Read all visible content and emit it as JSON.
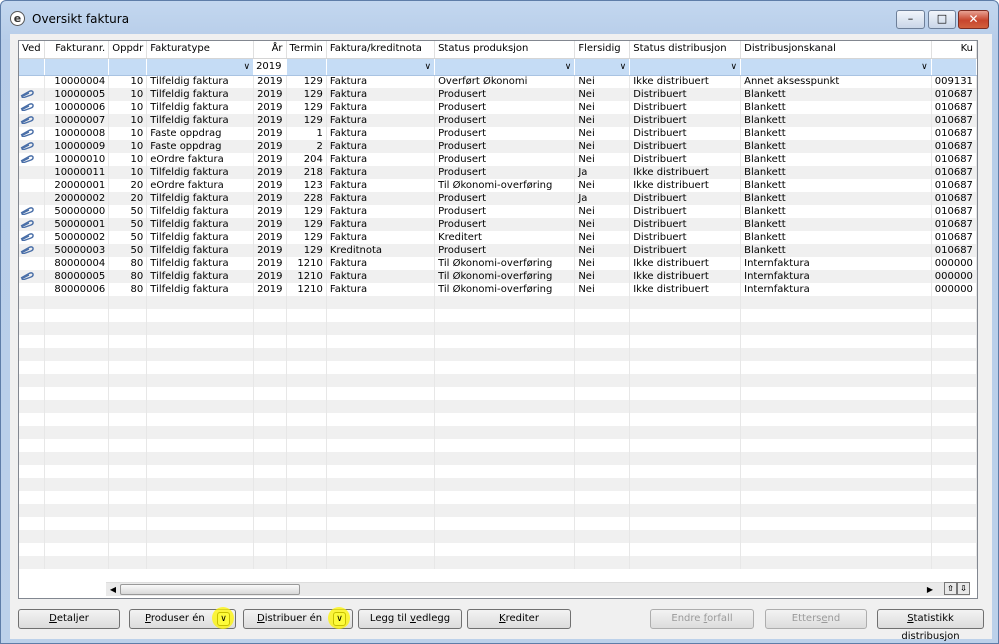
{
  "window": {
    "title": "Oversikt faktura",
    "icon": "app-e-icon",
    "min": "minimize-icon",
    "max": "maximize-icon",
    "close": "close-icon"
  },
  "columns": [
    {
      "label": "Ved"
    },
    {
      "label": "Fakturanr."
    },
    {
      "label": "Oppdr"
    },
    {
      "label": "Fakturatype"
    },
    {
      "label": "År"
    },
    {
      "label": "Termin"
    },
    {
      "label": "Faktura/kreditnota"
    },
    {
      "label": "Status produksjon"
    },
    {
      "label": "Flersidig"
    },
    {
      "label": "Status distribusjon"
    },
    {
      "label": "Distribusjonskanal"
    },
    {
      "label": "Ku"
    }
  ],
  "filter": {
    "year": "2019"
  },
  "rows": [
    {
      "clip": false,
      "nr": "10000004",
      "oppdr": "10",
      "type": "Tilfeldig faktura",
      "ar": "2019",
      "termin": "129",
      "fk": "Faktura",
      "status": "Overført Økonomi",
      "fler": "Nei",
      "dist": "Ikke distribuert",
      "kanal": "Annet aksesspunkt",
      "ku": "009131"
    },
    {
      "clip": true,
      "nr": "10000005",
      "oppdr": "10",
      "type": "Tilfeldig faktura",
      "ar": "2019",
      "termin": "129",
      "fk": "Faktura",
      "status": "Produsert",
      "fler": "Nei",
      "dist": "Distribuert",
      "kanal": "Blankett",
      "ku": "010687"
    },
    {
      "clip": true,
      "nr": "10000006",
      "oppdr": "10",
      "type": "Tilfeldig faktura",
      "ar": "2019",
      "termin": "129",
      "fk": "Faktura",
      "status": "Produsert",
      "fler": "Nei",
      "dist": "Distribuert",
      "kanal": "Blankett",
      "ku": "010687"
    },
    {
      "clip": true,
      "nr": "10000007",
      "oppdr": "10",
      "type": "Tilfeldig faktura",
      "ar": "2019",
      "termin": "129",
      "fk": "Faktura",
      "status": "Produsert",
      "fler": "Nei",
      "dist": "Distribuert",
      "kanal": "Blankett",
      "ku": "010687"
    },
    {
      "clip": true,
      "nr": "10000008",
      "oppdr": "10",
      "type": "Faste oppdrag",
      "ar": "2019",
      "termin": "1",
      "fk": "Faktura",
      "status": "Produsert",
      "fler": "Nei",
      "dist": "Distribuert",
      "kanal": "Blankett",
      "ku": "010687"
    },
    {
      "clip": true,
      "nr": "10000009",
      "oppdr": "10",
      "type": "Faste oppdrag",
      "ar": "2019",
      "termin": "2",
      "fk": "Faktura",
      "status": "Produsert",
      "fler": "Nei",
      "dist": "Distribuert",
      "kanal": "Blankett",
      "ku": "010687"
    },
    {
      "clip": true,
      "nr": "10000010",
      "oppdr": "10",
      "type": "eOrdre faktura",
      "ar": "2019",
      "termin": "204",
      "fk": "Faktura",
      "status": "Produsert",
      "fler": "Nei",
      "dist": "Distribuert",
      "kanal": "Blankett",
      "ku": "010687"
    },
    {
      "clip": false,
      "nr": "10000011",
      "oppdr": "10",
      "type": "Tilfeldig faktura",
      "ar": "2019",
      "termin": "218",
      "fk": "Faktura",
      "status": "Produsert",
      "fler": "Ja",
      "dist": "Ikke distribuert",
      "kanal": "Blankett",
      "ku": "010687"
    },
    {
      "clip": false,
      "nr": "20000001",
      "oppdr": "20",
      "type": "eOrdre faktura",
      "ar": "2019",
      "termin": "123",
      "fk": "Faktura",
      "status": "Til Økonomi-overføring",
      "fler": "Nei",
      "dist": "Ikke distribuert",
      "kanal": "Blankett",
      "ku": "010687"
    },
    {
      "clip": false,
      "nr": "20000002",
      "oppdr": "20",
      "type": "Tilfeldig faktura",
      "ar": "2019",
      "termin": "228",
      "fk": "Faktura",
      "status": "Produsert",
      "fler": "Ja",
      "dist": "Distribuert",
      "kanal": "Blankett",
      "ku": "010687"
    },
    {
      "clip": true,
      "nr": "50000000",
      "oppdr": "50",
      "type": "Tilfeldig faktura",
      "ar": "2019",
      "termin": "129",
      "fk": "Faktura",
      "status": "Produsert",
      "fler": "Nei",
      "dist": "Distribuert",
      "kanal": "Blankett",
      "ku": "010687"
    },
    {
      "clip": true,
      "nr": "50000001",
      "oppdr": "50",
      "type": "Tilfeldig faktura",
      "ar": "2019",
      "termin": "129",
      "fk": "Faktura",
      "status": "Produsert",
      "fler": "Nei",
      "dist": "Distribuert",
      "kanal": "Blankett",
      "ku": "010687"
    },
    {
      "clip": true,
      "nr": "50000002",
      "oppdr": "50",
      "type": "Tilfeldig faktura",
      "ar": "2019",
      "termin": "129",
      "fk": "Faktura",
      "status": "Kreditert",
      "fler": "Nei",
      "dist": "Distribuert",
      "kanal": "Blankett",
      "ku": "010687"
    },
    {
      "clip": true,
      "nr": "50000003",
      "oppdr": "50",
      "type": "Tilfeldig faktura",
      "ar": "2019",
      "termin": "129",
      "fk": "Kreditnota",
      "status": "Produsert",
      "fler": "Nei",
      "dist": "Distribuert",
      "kanal": "Blankett",
      "ku": "010687"
    },
    {
      "clip": false,
      "nr": "80000004",
      "oppdr": "80",
      "type": "Tilfeldig faktura",
      "ar": "2019",
      "termin": "1210",
      "fk": "Faktura",
      "status": "Til Økonomi-overføring",
      "fler": "Nei",
      "dist": "Ikke distribuert",
      "kanal": "Internfaktura",
      "ku": "000000"
    },
    {
      "clip": true,
      "nr": "80000005",
      "oppdr": "80",
      "type": "Tilfeldig faktura",
      "ar": "2019",
      "termin": "1210",
      "fk": "Faktura",
      "status": "Til Økonomi-overføring",
      "fler": "Nei",
      "dist": "Ikke distribuert",
      "kanal": "Internfaktura",
      "ku": "000000"
    },
    {
      "clip": false,
      "nr": "80000006",
      "oppdr": "80",
      "type": "Tilfeldig faktura",
      "ar": "2019",
      "termin": "1210",
      "fk": "Faktura",
      "status": "Til Økonomi-overføring",
      "fler": "Nei",
      "dist": "Ikke distribuert",
      "kanal": "Internfaktura",
      "ku": "000000"
    }
  ],
  "buttons": {
    "detaljer": {
      "pre": "",
      "u": "D",
      "post": "etaljer"
    },
    "produser": {
      "pre": "",
      "u": "P",
      "post": "roduser én"
    },
    "distribuer": {
      "pre": "",
      "u": "D",
      "post": "istribuer én"
    },
    "vedlegg": {
      "pre": "Legg til ",
      "u": "v",
      "post": "edlegg"
    },
    "krediter": {
      "pre": "",
      "u": "K",
      "post": "rediter"
    },
    "forfall": {
      "pre": "Endre ",
      "u": "f",
      "post": "orfall"
    },
    "ettersend": {
      "pre": "Etters",
      "u": "e",
      "post": "nd"
    },
    "statistikk": {
      "pre": "",
      "u": "S",
      "post": "tatistikk distribusjon"
    }
  },
  "colors": {
    "highlight": "#fff500",
    "filterRow": "#c5dcf5"
  }
}
